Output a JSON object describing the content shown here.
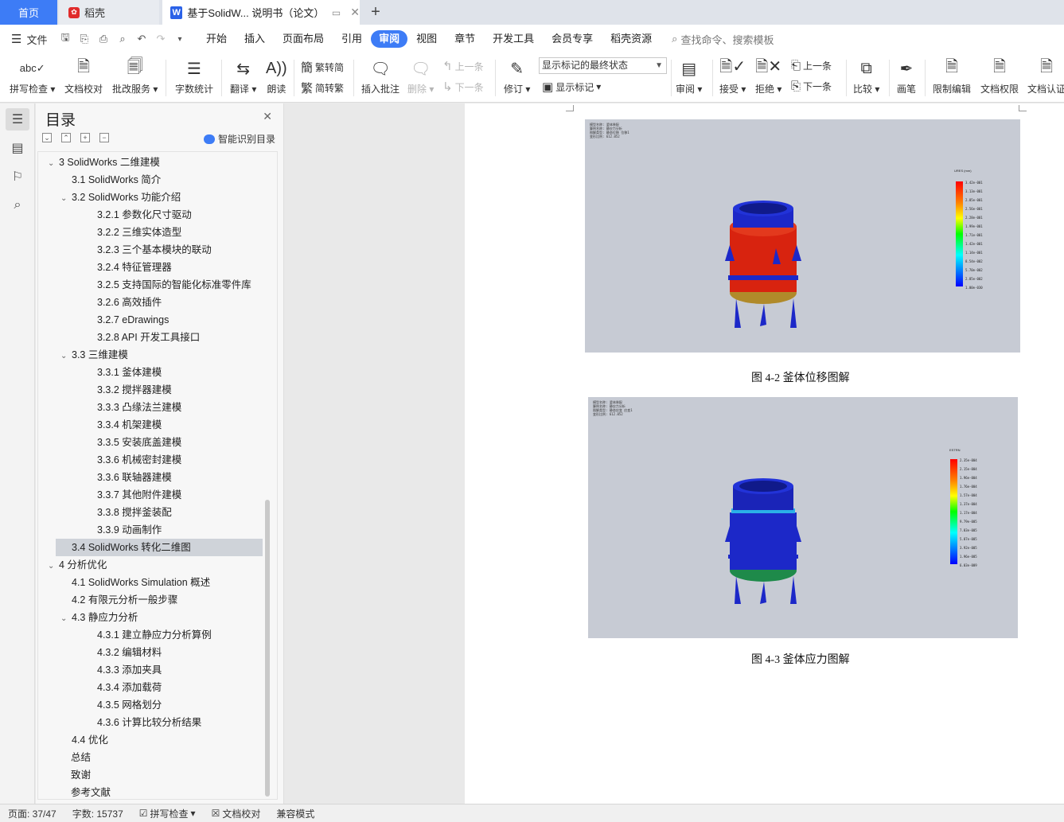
{
  "tabs": {
    "home": "首页",
    "daoke": "稻壳",
    "doc": "基于SolidW... 说明书（论文）"
  },
  "menu": {
    "file": "文件",
    "items": [
      "开始",
      "插入",
      "页面布局",
      "引用",
      "审阅",
      "视图",
      "章节",
      "开发工具",
      "会员专享",
      "稻壳资源"
    ],
    "active": "审阅",
    "search": "查找命令、搜索模板"
  },
  "ribbon": {
    "spellcheck": "拼写检查",
    "doc_proof": "文档校对",
    "correction_service": "批改服务",
    "word_count": "字数统计",
    "translate": "翻译",
    "read_aloud": "朗读",
    "trad_to_simp": "繁转简",
    "simp_to_trad": "简转繁",
    "insert_comment": "插入批注",
    "delete": "删除",
    "prev_comment": "上一条",
    "next_comment": "下一条",
    "track_changes": "修订",
    "markup_state": "显示标记的最终状态",
    "show_markup": "显示标记",
    "review": "审阅",
    "accept": "接受",
    "reject": "拒绝",
    "prev_change": "上一条",
    "next_change": "下一条",
    "compare": "比较",
    "pen": "画笔",
    "restrict_editing": "限制编辑",
    "doc_permission": "文档权限",
    "doc_certify": "文档认证"
  },
  "toc": {
    "title": "目录",
    "smart": "智能识别目录",
    "items": [
      {
        "text": "3 SolidWorks 二维建模",
        "level": 1,
        "caret": "v"
      },
      {
        "text": "3.1 SolidWorks 简介",
        "level": 2,
        "caret": ""
      },
      {
        "text": "3.2 SolidWorks 功能介绍",
        "level": 2,
        "caret": "v"
      },
      {
        "text": "3.2.1  参数化尺寸驱动",
        "level": 3,
        "caret": ""
      },
      {
        "text": "3.2.2  三维实体造型",
        "level": 3,
        "caret": ""
      },
      {
        "text": "3.2.3  三个基本模块的联动",
        "level": 3,
        "caret": ""
      },
      {
        "text": "3.2.4  特征管理器",
        "level": 3,
        "caret": ""
      },
      {
        "text": "3.2.5  支持国际的智能化标准零件库",
        "level": 3,
        "caret": ""
      },
      {
        "text": "3.2.6  高效插件",
        "level": 3,
        "caret": ""
      },
      {
        "text": "3.2.7 eDrawings",
        "level": 3,
        "caret": ""
      },
      {
        "text": "3.2.8 API 开发工具接口",
        "level": 3,
        "caret": ""
      },
      {
        "text": "3.3  三维建模",
        "level": 2,
        "caret": "v"
      },
      {
        "text": "3.3.1  釜体建模",
        "level": 3,
        "caret": ""
      },
      {
        "text": "3.3.2  搅拌器建模",
        "level": 3,
        "caret": ""
      },
      {
        "text": "3.3.3  凸缘法兰建模",
        "level": 3,
        "caret": ""
      },
      {
        "text": "3.3.4  机架建模",
        "level": 3,
        "caret": ""
      },
      {
        "text": "3.3.5  安装底盖建模",
        "level": 3,
        "caret": ""
      },
      {
        "text": "3.3.6  机械密封建模",
        "level": 3,
        "caret": ""
      },
      {
        "text": "3.3.6  联轴器建模",
        "level": 3,
        "caret": ""
      },
      {
        "text": "3.3.7  其他附件建模",
        "level": 3,
        "caret": ""
      },
      {
        "text": "3.3.8  搅拌釜装配",
        "level": 3,
        "caret": ""
      },
      {
        "text": "3.3.9  动画制作",
        "level": 3,
        "caret": ""
      },
      {
        "text": "3.4 SolidWorks 转化二维图",
        "level": 2,
        "caret": "",
        "selected": true
      },
      {
        "text": "4  分析优化",
        "level": 1,
        "caret": "v"
      },
      {
        "text": "4.1 SolidWorks Simulation 概述",
        "level": 2,
        "caret": ""
      },
      {
        "text": "4.2  有限元分析一般步骤",
        "level": 2,
        "caret": ""
      },
      {
        "text": "4.3  静应力分析",
        "level": 2,
        "caret": "v"
      },
      {
        "text": "4.3.1  建立静应力分析算例",
        "level": 3,
        "caret": ""
      },
      {
        "text": "4.3.2  编辑材料",
        "level": 3,
        "caret": ""
      },
      {
        "text": "4.3.3  添加夹具",
        "level": 3,
        "caret": ""
      },
      {
        "text": "4.3.4  添加载荷",
        "level": 3,
        "caret": ""
      },
      {
        "text": "4.3.5  网格划分",
        "level": 3,
        "caret": ""
      },
      {
        "text": "4.3.6  计算比较分析结果",
        "level": 3,
        "caret": ""
      },
      {
        "text": "4.4  优化",
        "level": 2,
        "caret": ""
      },
      {
        "text": "总结",
        "level": 0,
        "caret": ""
      },
      {
        "text": "致谢",
        "level": 0,
        "caret": ""
      },
      {
        "text": "参考文献",
        "level": 0,
        "caret": ""
      }
    ]
  },
  "document": {
    "figure1": {
      "caption": "图 4-2  釜体位移图解",
      "legend_title": "URES (mm)",
      "legend_values": [
        "3.42e-001",
        "3.13e-001",
        "2.85e-001",
        "2.56e-001",
        "2.28e-001",
        "1.99e-001",
        "1.71e-001",
        "1.42e-001",
        "1.14e-001",
        "8.54e-002",
        "5.70e-002",
        "2.85e-002",
        "1.00e-030"
      ],
      "info_lines": [
        "模型名称: 釜体装配",
        "算例名称: 静应力分析",
        "图解类型: 静态位移 位移1",
        "变形比例: 612.052"
      ]
    },
    "figure2": {
      "caption": "图 4-3  釜体应力图解",
      "legend_title": "ESTRN",
      "legend_values": [
        "2.35e-004",
        "2.15e-004",
        "1.96e-004",
        "1.76e-004",
        "1.57e-004",
        "1.37e-004",
        "1.17e-004",
        "9.79e-005",
        "7.83e-005",
        "5.87e-005",
        "3.92e-005",
        "1.96e-005",
        "6.03e-009"
      ],
      "info_lines": [
        "模型名称: 釜体装配",
        "算例名称: 静应力分析",
        "图解类型: 静态应变 应变1",
        "变形比例: 612.052"
      ]
    }
  },
  "status": {
    "page": "页面: 37/47",
    "words": "字数: 15737",
    "spellcheck": "拼写检查",
    "proof": "文档校对",
    "compat": "兼容模式"
  },
  "colors": {
    "accent": "#3d7cf6",
    "red_body": "#d8230f",
    "blue_body": "#1c28c8"
  }
}
